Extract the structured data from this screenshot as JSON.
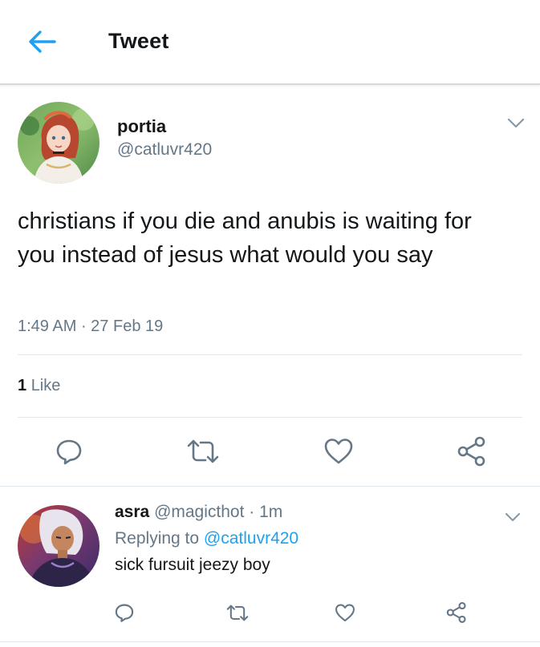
{
  "header": {
    "title": "Tweet",
    "back_icon": "arrow-left-icon"
  },
  "colors": {
    "accent": "#1da1f2",
    "secondary_text": "#657786",
    "primary_text": "#14171a",
    "divider": "#e1e8ed"
  },
  "tweet": {
    "name": "portia",
    "handle": "@catluvr420",
    "text": "christians if you die and anubis is waiting for you instead of jesus what would you say",
    "time": "1:49 AM",
    "date": "27 Feb 19",
    "likes_count": "1",
    "likes_label": "Like"
  },
  "reply": {
    "name": "asra",
    "handle": "@magicthot",
    "age": "1m",
    "replying_to_label": "Replying to",
    "replying_to_handle": "@catluvr420",
    "text": "sick fursuit jeezy boy"
  },
  "actions": [
    "reply-icon",
    "retweet-icon",
    "heart-icon",
    "share-icon"
  ]
}
